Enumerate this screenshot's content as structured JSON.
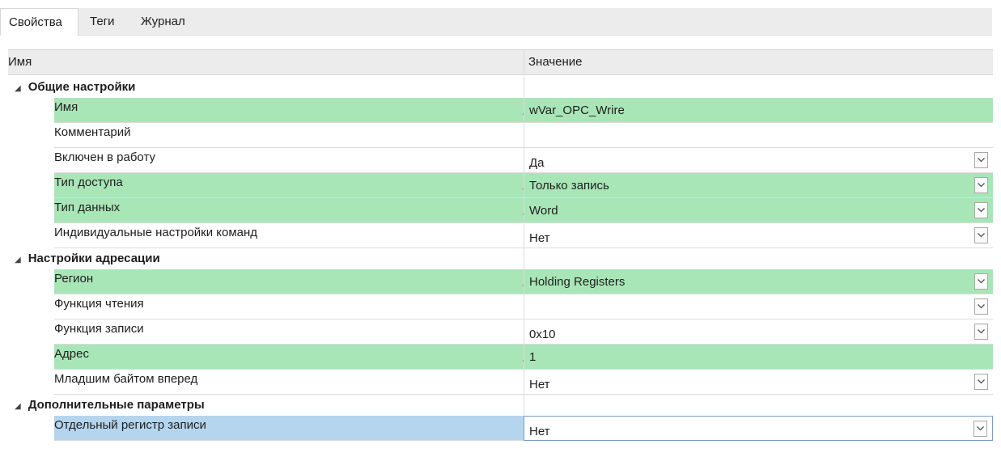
{
  "tabs": [
    "Свойства",
    "Теги",
    "Журнал"
  ],
  "active_tab": "Свойства",
  "columns": {
    "name": "Имя",
    "value": "Значение"
  },
  "colors": {
    "edited_row": "#a9e6b7",
    "selected_row": "#b5d5ee",
    "header_bg": "#ececec"
  },
  "groups": [
    {
      "title": "Общие настройки",
      "rows": [
        {
          "name": "Имя",
          "value": "wVar_OPC_Wrire",
          "edited": true,
          "dropdown": false
        },
        {
          "name": "Комментарий",
          "value": "",
          "edited": false,
          "dropdown": false
        },
        {
          "name": "Включен в работу",
          "value": "Да",
          "edited": false,
          "dropdown": true
        },
        {
          "name": "Тип доступа",
          "value": "Только запись",
          "edited": true,
          "dropdown": true
        },
        {
          "name": "Тип данных",
          "value": "Word",
          "edited": true,
          "dropdown": true
        },
        {
          "name": "Индивидуальные настройки команд",
          "value": "Нет",
          "edited": false,
          "dropdown": true
        }
      ]
    },
    {
      "title": "Настройки адресации",
      "rows": [
        {
          "name": "Регион",
          "value": "Holding Registers",
          "edited": true,
          "dropdown": true
        },
        {
          "name": "Функция чтения",
          "value": "",
          "edited": false,
          "dropdown": true
        },
        {
          "name": "Функция записи",
          "value": "0x10",
          "edited": false,
          "dropdown": true
        },
        {
          "name": "Адрес",
          "value": "1",
          "edited": true,
          "dropdown": false
        },
        {
          "name": "Младшим байтом вперед",
          "value": "Нет",
          "edited": false,
          "dropdown": true
        }
      ]
    },
    {
      "title": "Дополнительные параметры",
      "rows": [
        {
          "name": "Отдельный регистр записи",
          "value": "Нет",
          "edited": false,
          "selected": true,
          "dropdown": true
        }
      ]
    }
  ]
}
